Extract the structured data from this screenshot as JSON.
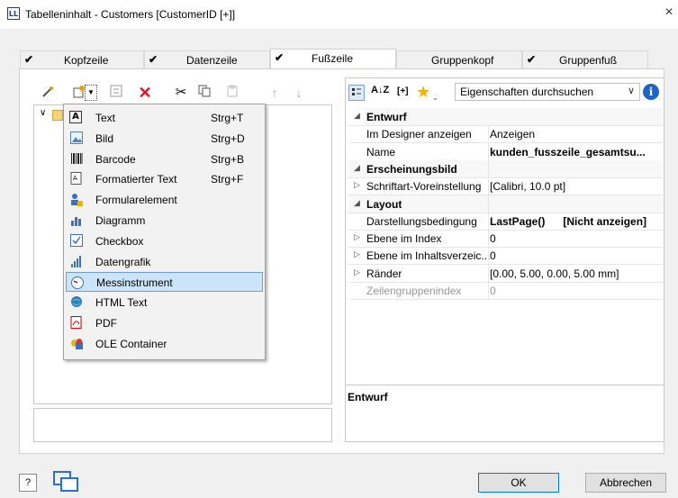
{
  "window": {
    "title": "Tabelleninhalt - Customers [CustomerID [+]]",
    "app_icon": "LL",
    "close": "×"
  },
  "tabs": [
    {
      "label": "Kopfzeile",
      "checked": true
    },
    {
      "label": "Datenzeile",
      "checked": true
    },
    {
      "label": "Fußzeile",
      "checked": true,
      "active": true
    },
    {
      "label": "Gruppenkopf",
      "checked": false
    },
    {
      "label": "Gruppenfuß",
      "checked": true
    }
  ],
  "check_glyph": "✔",
  "menu": {
    "items": [
      {
        "label": "Text",
        "shortcut": "Strg+T",
        "icon": "text-icon"
      },
      {
        "label": "Bild",
        "shortcut": "Strg+D",
        "icon": "image-icon"
      },
      {
        "label": "Barcode",
        "shortcut": "Strg+B",
        "icon": "barcode-icon"
      },
      {
        "label": "Formatierter Text",
        "shortcut": "Strg+F",
        "icon": "formatted-text-icon"
      },
      {
        "label": "Formularelement",
        "shortcut": "",
        "icon": "form-element-icon"
      },
      {
        "label": "Diagramm",
        "shortcut": "",
        "icon": "chart-icon"
      },
      {
        "label": "Checkbox",
        "shortcut": "",
        "icon": "checkbox-icon"
      },
      {
        "label": "Datengrafik",
        "shortcut": "",
        "icon": "data-graphic-icon"
      },
      {
        "label": "Messinstrument",
        "shortcut": "",
        "icon": "gauge-icon",
        "highlighted": true
      },
      {
        "label": "HTML Text",
        "shortcut": "",
        "icon": "html-icon"
      },
      {
        "label": "PDF",
        "shortcut": "",
        "icon": "pdf-icon"
      },
      {
        "label": "OLE Container",
        "shortcut": "",
        "icon": "ole-icon"
      }
    ]
  },
  "properties": {
    "search_placeholder": "Eigenschaften durchsuchen",
    "sort_label": "A↓Z",
    "expand_label": "[+]",
    "rows": [
      {
        "type": "cat",
        "key": "Entwurf",
        "value": "",
        "exp": "◢"
      },
      {
        "type": "prop",
        "key": "Im Designer anzeigen",
        "value": "Anzeigen"
      },
      {
        "type": "prop",
        "key": "Name",
        "value": "kunden_fusszeile_gesamtsu...",
        "bold": true
      },
      {
        "type": "cat",
        "key": "Erscheinungsbild",
        "value": "",
        "exp": "◢"
      },
      {
        "type": "prop",
        "key": "Schriftart-Voreinstellung",
        "value": "[Calibri, 10.0 pt]",
        "exp": "▷"
      },
      {
        "type": "cat",
        "key": "Layout",
        "value": "",
        "exp": "◢"
      },
      {
        "type": "prop",
        "key": "Darstellungsbedingung",
        "value": "LastPage()      [Nicht anzeigen]",
        "bold": true
      },
      {
        "type": "prop",
        "key": "Ebene im Index",
        "value": "0",
        "exp": "▷"
      },
      {
        "type": "prop",
        "key": "Ebene im Inhaltsverzeic...",
        "value": "0",
        "exp": "▷"
      },
      {
        "type": "prop",
        "key": "Ränder",
        "value": "[0.00, 5.00, 0.00, 5.00 mm]",
        "exp": "▷"
      },
      {
        "type": "prop",
        "key": "Zeilengruppenindex",
        "value": "0",
        "disabled": true
      }
    ],
    "description_title": "Entwurf"
  },
  "buttons": {
    "ok": "OK",
    "cancel": "Abbrechen"
  },
  "colors": {
    "accent": "#0078d7",
    "highlight": "#cce4f7",
    "delete": "#e81123"
  }
}
